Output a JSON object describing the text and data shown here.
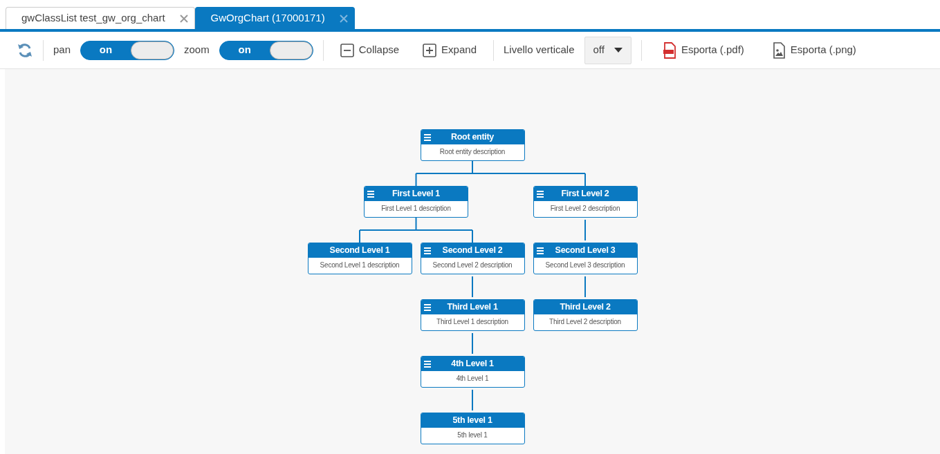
{
  "tabs": [
    {
      "label": "gwClassList test_gw_org_chart",
      "selected": false
    },
    {
      "label": "GwOrgChart (17000171)",
      "selected": true
    }
  ],
  "toolbar": {
    "toggles": [
      {
        "label": "pan",
        "state_text": "on",
        "on": true
      },
      {
        "label": "zoom",
        "state_text": "on",
        "on": true
      }
    ],
    "collapse": "Collapse",
    "expand": "Expand",
    "vertical_level": {
      "label": "Livello verticale",
      "value": "off"
    },
    "exports": [
      {
        "kind": "pdf",
        "label": "Esporta (.pdf)"
      },
      {
        "kind": "png",
        "label": "Esporta (.png)"
      }
    ]
  },
  "chart": {
    "root": {
      "title": "Root entity",
      "description": "Root entity description",
      "children": [
        {
          "title": "First Level 1",
          "description": "First Level 1 description",
          "children": [
            {
              "title": "Second Level 1",
              "description": "Second Level 1 description"
            },
            {
              "title": "Second Level 2",
              "description": "Second Level 2 description",
              "children": [
                {
                  "title": "Third Level 1",
                  "description": "Third Level 1 description",
                  "children": [
                    {
                      "title": "4th Level 1",
                      "description": "4th Level 1",
                      "children": [
                        {
                          "title": "5th level 1",
                          "description": "5th level 1"
                        }
                      ]
                    }
                  ]
                }
              ]
            }
          ]
        },
        {
          "title": "First Level 2",
          "description": "First Level 2 description",
          "children": [
            {
              "title": "Second Level 3",
              "description": "Second Level 3 description",
              "children": [
                {
                  "title": "Third Level 2",
                  "description": "Third Level 2 description"
                }
              ]
            }
          ]
        }
      ]
    }
  }
}
